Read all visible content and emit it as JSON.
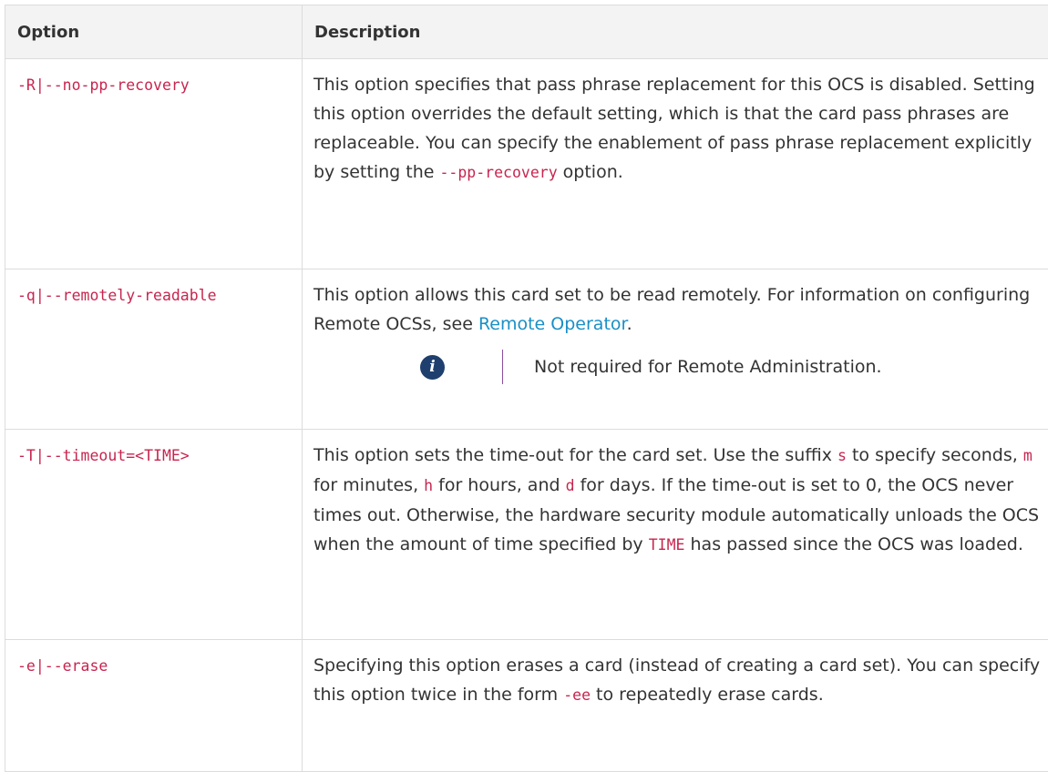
{
  "table": {
    "headers": [
      "Option",
      "Description"
    ],
    "rows": [
      {
        "option": "-R|--no-pp-recovery",
        "desc_1": "This option specifies that pass phrase replacement for this OCS is disabled. Setting this option overrides the default setting, which is that the card pass phrases are replaceable. You can specify the enablement of pass phrase replacement explicitly by setting the ",
        "code_1": "--pp-recovery",
        "desc_2": " option."
      },
      {
        "option": "-q|--remotely-readable",
        "desc_1": "This option allows this card set to be read remotely. For information on configuring Remote OCSs, see ",
        "link": "Remote Operator",
        "desc_2": ".",
        "note_icon": "info-icon",
        "note": "Not required for Remote Administration."
      },
      {
        "option": "-T|--timeout=<TIME>",
        "desc_1": "This option sets the time-out for the card set. Use the suffix ",
        "code_s": "s",
        "desc_2": " to specify seconds, ",
        "code_m": "m",
        "desc_3": " for minutes, ",
        "code_h": "h",
        "desc_4": " for hours, and ",
        "code_d": "d",
        "desc_5": " for days. If the time-out is set to 0, the OCS never times out. Otherwise, the hardware security module automatically unloads the OCS when the amount of time specified by ",
        "code_time": "TIME",
        "desc_6": " has passed since the OCS was loaded."
      },
      {
        "option": "-e|--erase",
        "desc_1": "Specifying this option erases a card (instead of creating a card set). You can specify this option twice in the form ",
        "code_1": "-ee",
        "desc_2": " to repeatedly erase cards."
      }
    ]
  },
  "colors": {
    "code": "#c7254e",
    "link": "#1a8fc7",
    "header_bg": "#f3f3f3",
    "border": "#dcdcdc",
    "icon_bg": "#1f3f6e",
    "note_bar": "#8b4fa0"
  }
}
